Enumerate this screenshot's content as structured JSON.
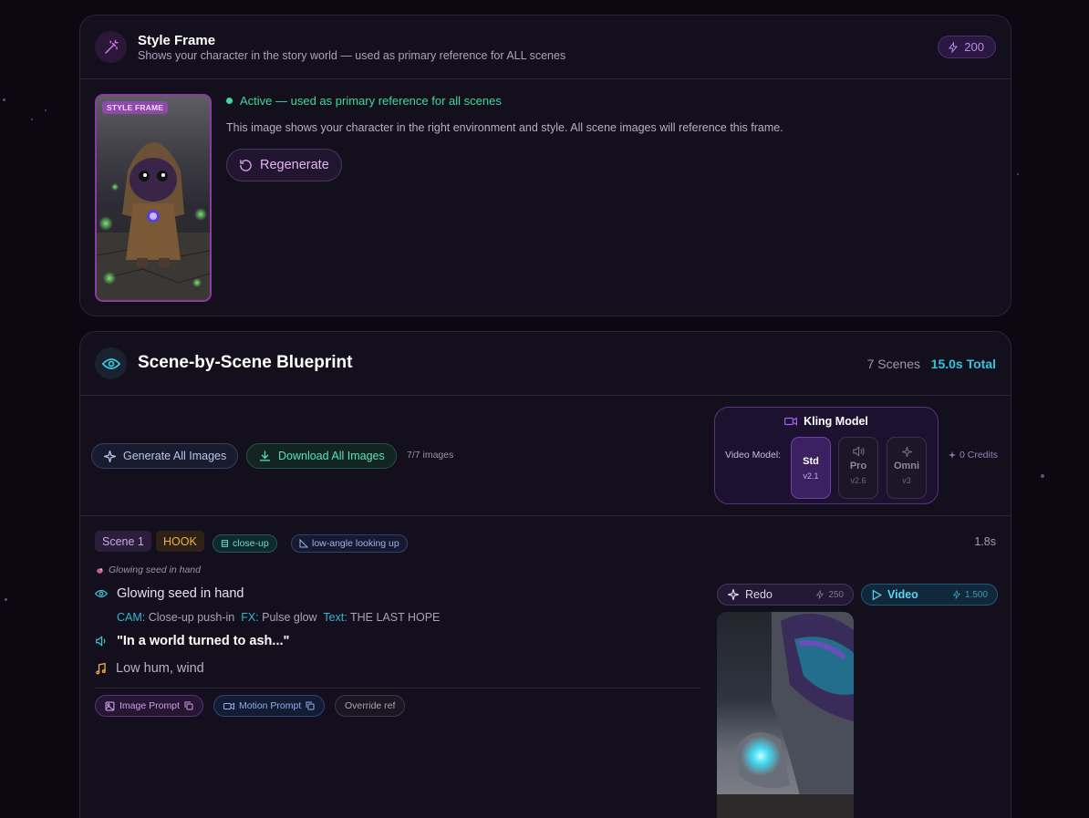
{
  "style_frame": {
    "title": "Style Frame",
    "subtitle": "Shows your character in the story world — used as primary reference for ALL scenes",
    "credits": "200",
    "badge": "STYLE FRAME",
    "active_text": "Active — used as primary reference for all scenes",
    "description": "This image shows your character in the right environment and style. All scene images will reference this frame.",
    "regenerate_label": "Regenerate"
  },
  "blueprint": {
    "title": "Scene-by-Scene Blueprint",
    "scene_count": "7 Scenes",
    "total_duration": "15.0s Total",
    "generate_all_label": "Generate All Images",
    "download_all_label": "Download All Images",
    "images_count": "7/7 images",
    "kling": {
      "title": "Kling Model",
      "video_model_label": "Video Model:",
      "models": [
        {
          "name": "Std",
          "version": "v2.1",
          "selected": true
        },
        {
          "name": "Pro",
          "version": "v2.6",
          "selected": false
        },
        {
          "name": "Omni",
          "version": "v3",
          "selected": false
        }
      ]
    },
    "credits_label": "0 Credits"
  },
  "scene": {
    "label": "Scene 1",
    "tag": "HOOK",
    "shot": "close-up",
    "angle": "low-angle looking up",
    "duration": "1.8s",
    "note": "Glowing seed in hand",
    "visual": "Glowing seed in hand",
    "cam_label": "CAM:",
    "cam_value": "Close-up push-in",
    "fx_label": "FX:",
    "fx_value": "Pulse glow",
    "text_label": "Text:",
    "text_value": "THE LAST HOPE",
    "voiceover": "\"In a world turned to ash...\"",
    "sound": "Low hum, wind",
    "image_prompt_label": "Image Prompt",
    "motion_prompt_label": "Motion Prompt",
    "override_label": "Override ref",
    "redo_label": "Redo",
    "redo_cost": "250",
    "video_label": "Video",
    "video_cost": "1.500"
  },
  "colors": {
    "accent_purple": "#8e3aa4",
    "accent_cyan": "#2ec6e0",
    "accent_green": "#3ed99d",
    "hook_orange": "#f0b140"
  }
}
